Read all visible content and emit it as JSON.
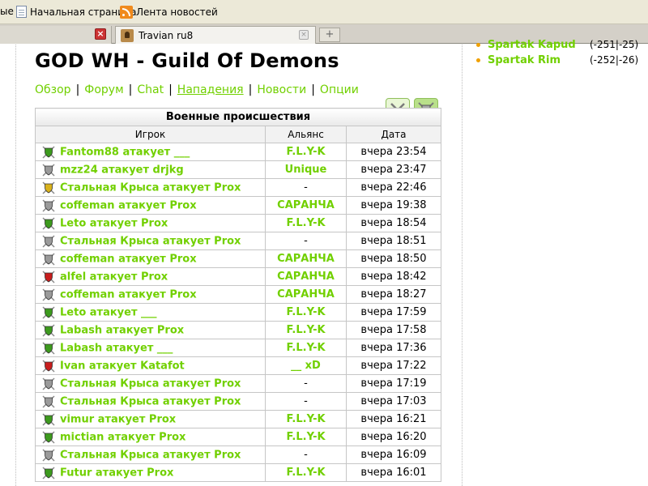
{
  "bookmarks": [
    {
      "label": "ые",
      "icon": "none"
    },
    {
      "label": "Начальная страница",
      "icon": "page-icon"
    },
    {
      "label": "Лента новостей",
      "icon": "rss-icon"
    }
  ],
  "tabs": {
    "active_label": "Travian ru8",
    "new_tab_symbol": "+"
  },
  "page": {
    "title": "GOD WH - Guild Of Demons",
    "nav": [
      "Обзор",
      "Форум",
      "Chat",
      "Нападения",
      "Новости",
      "Опции"
    ],
    "nav_active": "Нападения"
  },
  "sidebar": [
    {
      "name": "Spartak Kapud",
      "coords": "(-251|-25)"
    },
    {
      "name": "Spartak Rim",
      "coords": "(-252|-26)"
    }
  ],
  "table": {
    "caption": "Военные происшествия",
    "columns": [
      "Игрок",
      "Альянс",
      "Дата"
    ],
    "rows": [
      {
        "shield": "green",
        "player": "Fantom88 атакует ___",
        "alliance": "F.L.Y-K",
        "date": "вчера 23:54"
      },
      {
        "shield": "gray",
        "player": "mzz24 атакует drjkg",
        "alliance": "Unique",
        "date": "вчера 23:47"
      },
      {
        "shield": "yellow",
        "player": "Стальная Крыса атакует Prox",
        "alliance": "-",
        "date": "вчера 22:46"
      },
      {
        "shield": "gray",
        "player": "coffeman атакует Prox",
        "alliance": "САРАНЧА",
        "date": "вчера 19:38"
      },
      {
        "shield": "green",
        "player": "Leto атакует Prox",
        "alliance": "F.L.Y-K",
        "date": "вчера 18:54"
      },
      {
        "shield": "gray",
        "player": "Стальная Крыса атакует Prox",
        "alliance": "-",
        "date": "вчера 18:51"
      },
      {
        "shield": "gray",
        "player": "coffeman атакует Prox",
        "alliance": "САРАНЧА",
        "date": "вчера 18:50"
      },
      {
        "shield": "red",
        "player": "alfel атакует Prox",
        "alliance": "САРАНЧА",
        "date": "вчера 18:42"
      },
      {
        "shield": "gray",
        "player": "coffeman атакует Prox",
        "alliance": "САРАНЧА",
        "date": "вчера 18:27"
      },
      {
        "shield": "green",
        "player": "Leto атакует ___",
        "alliance": "F.L.Y-K",
        "date": "вчера 17:59"
      },
      {
        "shield": "green",
        "player": "Labash атакует Prox",
        "alliance": "F.L.Y-K",
        "date": "вчера 17:58"
      },
      {
        "shield": "green",
        "player": "Labash атакует ___",
        "alliance": "F.L.Y-K",
        "date": "вчера 17:36"
      },
      {
        "shield": "red",
        "player": "Ivan атакует Katafot",
        "alliance": "__ xD",
        "date": "вчера 17:22"
      },
      {
        "shield": "gray",
        "player": "Стальная Крыса атакует Prox",
        "alliance": "-",
        "date": "вчера 17:19"
      },
      {
        "shield": "gray",
        "player": "Стальная Крыса атакует Prox",
        "alliance": "-",
        "date": "вчера 17:03"
      },
      {
        "shield": "green",
        "player": "vimur атакует Prox",
        "alliance": "F.L.Y-K",
        "date": "вчера 16:21"
      },
      {
        "shield": "green",
        "player": "mictian атакует Prox",
        "alliance": "F.L.Y-K",
        "date": "вчера 16:20"
      },
      {
        "shield": "gray",
        "player": "Стальная Крыса атакует Prox",
        "alliance": "-",
        "date": "вчера 16:09"
      },
      {
        "shield": "green",
        "player": "Futur атакует Prox",
        "alliance": "F.L.Y-K",
        "date": "вчера 16:01"
      }
    ]
  },
  "colors": {
    "link_green": "#71d000",
    "shield_green": "#3d9a1e",
    "shield_gray": "#9a9a9a",
    "shield_yellow": "#d9b21c",
    "shield_red": "#c81e1e"
  },
  "icons": [
    "sword-cross-icon",
    "shield-swords-icon",
    "page-icon",
    "rss-icon",
    "travian-icon",
    "close-icon"
  ]
}
